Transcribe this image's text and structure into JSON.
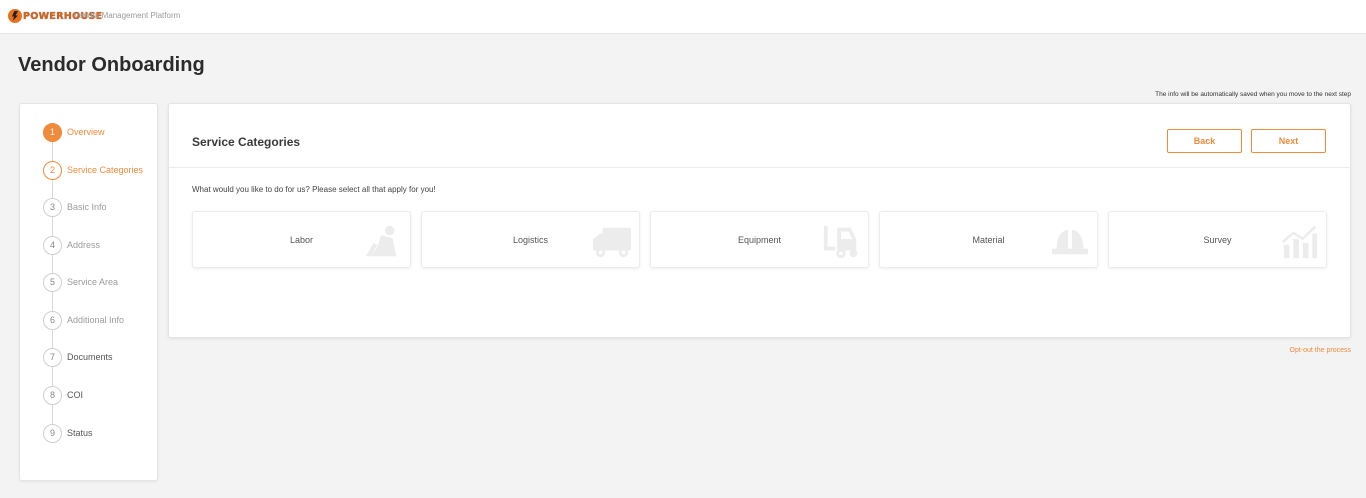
{
  "header": {
    "brand": "POWERHOUSE",
    "platform_name": "Vendor Management Platform"
  },
  "page": {
    "title": "Vendor Onboarding"
  },
  "autosave_note": "The info will be automatically saved when you move to the next step",
  "steps": [
    {
      "num": "1",
      "label": "Overview",
      "state": "done"
    },
    {
      "num": "2",
      "label": "Service Categories",
      "state": "active"
    },
    {
      "num": "3",
      "label": "Basic Info",
      "state": "pending"
    },
    {
      "num": "4",
      "label": "Address",
      "state": "pending"
    },
    {
      "num": "5",
      "label": "Service Area",
      "state": "pending"
    },
    {
      "num": "6",
      "label": "Additional Info",
      "state": "pending"
    },
    {
      "num": "7",
      "label": "Documents",
      "state": "pending"
    },
    {
      "num": "8",
      "label": "COI",
      "state": "pending"
    },
    {
      "num": "9",
      "label": "Status",
      "state": "pending"
    }
  ],
  "card": {
    "title": "Service Categories",
    "back_label": "Back",
    "next_label": "Next",
    "question": "What would you like to do for us? Please select all that apply for you!"
  },
  "categories": [
    {
      "label": "Labor",
      "icon": "worker-icon"
    },
    {
      "label": "Logistics",
      "icon": "truck-icon"
    },
    {
      "label": "Equipment",
      "icon": "forklift-icon"
    },
    {
      "label": "Material",
      "icon": "hardhat-icon"
    },
    {
      "label": "Survey",
      "icon": "chart-icon"
    }
  ],
  "optout_label": "Opt-out the process",
  "colors": {
    "accent": "#f08a3c",
    "background": "#f3f3f3"
  }
}
